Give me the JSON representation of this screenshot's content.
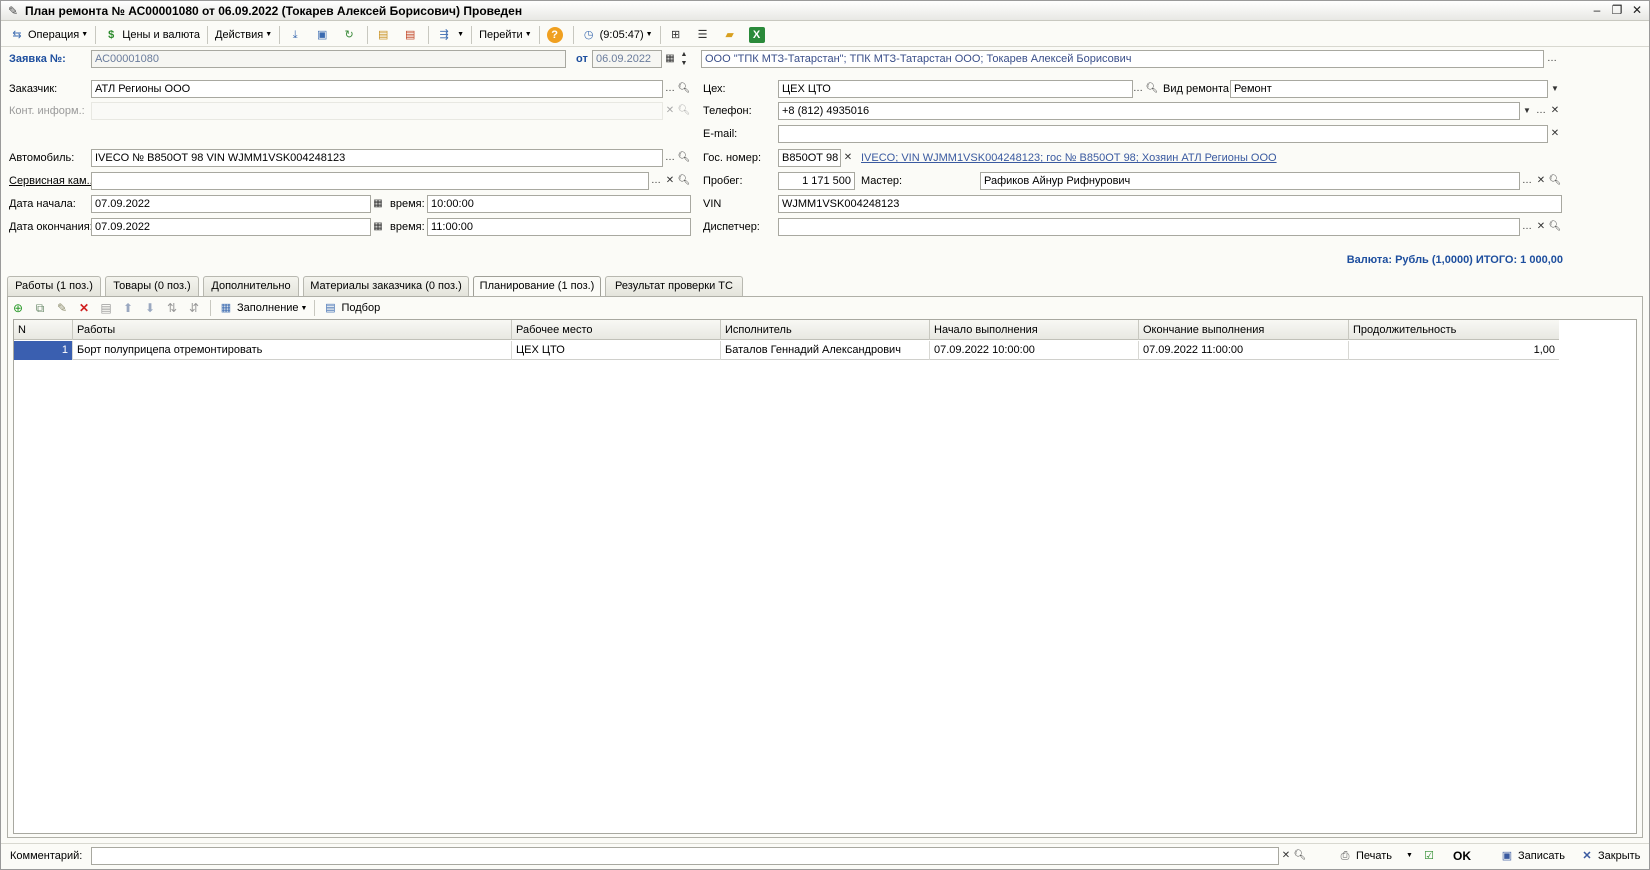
{
  "window": {
    "title": "План ремонта № АС00001080 от 06.09.2022 (Токарев Алексей Борисович) Проведен"
  },
  "toolbar": {
    "operation": "Операция",
    "prices": "Цены и валюта",
    "actions": "Действия",
    "goto": "Перейти",
    "time": "(9:05:47)"
  },
  "header": {
    "order_label": "Заявка №:",
    "order_value": "АС00001080",
    "from_label": "от",
    "from_value": "06.09.2022",
    "org_value": "ООО \"ТПК МТЗ-Татарстан\"; ТПК МТЗ-Татарстан ООО; Токарев Алексей Борисович"
  },
  "form": {
    "customer_label": "Заказчик:",
    "customer_value": "АТЛ Регионы ООО",
    "contact_label": "Конт. информ.:",
    "contact_value": "",
    "car_label": "Автомобиль:",
    "car_value": "IVECO № В850ОТ 98 VIN WJMM1VSK004248123",
    "service_label": "Сервисная кам...",
    "service_value": "",
    "start_label": "Дата начала:",
    "start_value": "07.09.2022",
    "start_time_label": "время:",
    "start_time_value": "10:00:00",
    "end_label": "Дата окончания:",
    "end_value": "07.09.2022",
    "end_time_label": "время:",
    "end_time_value": "11:00:00",
    "shop_label": "Цех:",
    "shop_value": "ЦЕХ ЦТО",
    "repair_type_label": "Вид ремонта:",
    "repair_type_value": "Ремонт",
    "phone_label": "Телефон:",
    "phone_value": "+8 (812) 4935016",
    "email_label": "E-mail:",
    "email_value": "",
    "plate_label": "Гос. номер:",
    "plate_value": "В850ОТ 98",
    "car_link": "IVECO; VIN WJMM1VSK004248123; гос № В850ОТ 98; Хозяин АТЛ Регионы ООО",
    "mileage_label": "Пробег:",
    "mileage_value": "1 171 500",
    "master_label": "Мастер:",
    "master_value": "Рафиков Айнур Рифнурович",
    "vin_label": "VIN",
    "vin_value": "WJMM1VSK004248123",
    "dispatcher_label": "Диспетчер:",
    "dispatcher_value": "",
    "currency_total": "Валюта: Рубль (1,0000) ИТОГО: 1 000,00"
  },
  "tabs": [
    {
      "label": "Работы (1 поз.)"
    },
    {
      "label": "Товары (0 поз.)"
    },
    {
      "label": "Дополнительно"
    },
    {
      "label": "Материалы заказчика (0 поз.)"
    },
    {
      "label": "Планирование (1 поз.)"
    },
    {
      "label": "Результат проверки ТС"
    }
  ],
  "grid_toolbar": {
    "fill": "Заполнение",
    "select": "Подбор"
  },
  "grid": {
    "columns": [
      "N",
      "Работы",
      "Рабочее место",
      "Исполнитель",
      "Начало выполнения",
      "Окончание выполнения",
      "Продолжительность"
    ],
    "rows": [
      {
        "n": "1",
        "work": "Борт полуприцепа отремонтировать",
        "place": "ЦЕХ ЦТО",
        "executor": "Баталов Геннадий Александрович",
        "start": "07.09.2022 10:00:00",
        "end": "07.09.2022 11:00:00",
        "duration": "1,00"
      }
    ]
  },
  "footer": {
    "comment_label": "Комментарий:",
    "comment_value": "",
    "print": "Печать",
    "ok": "OK",
    "save": "Записать",
    "close": "Закрыть"
  },
  "colors": {
    "accent_blue": "#1d4e9e",
    "selection": "#3a5fb0"
  }
}
